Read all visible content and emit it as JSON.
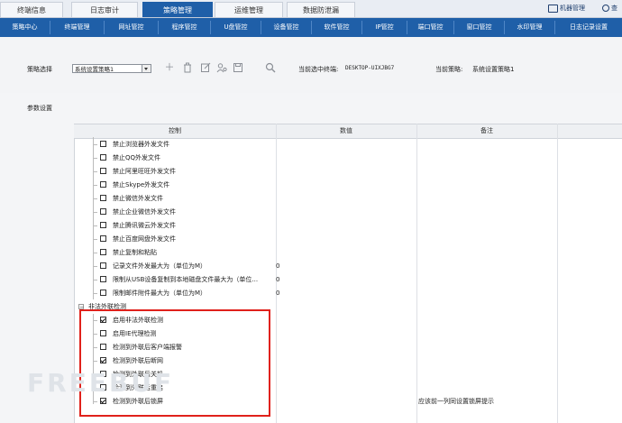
{
  "top_tabs": [
    {
      "label": "终端信息",
      "active": false
    },
    {
      "label": "日志审计",
      "active": false
    },
    {
      "label": "策略管理",
      "active": true
    },
    {
      "label": "运维管理",
      "active": false
    },
    {
      "label": "数据防泄漏",
      "active": false
    }
  ],
  "top_right": {
    "monitor_label": "机器管理",
    "search_label": "查"
  },
  "sub_tabs": [
    "策略中心",
    "终端管理",
    "网址管控",
    "程序管控",
    "U盘管控",
    "设备管控",
    "软件管控",
    "IP管控",
    "端口管控",
    "窗口管控",
    "水印管理",
    "日志记录设置"
  ],
  "policy_bar": {
    "select_label": "策略选择",
    "selected_policy": "系统设置策略1",
    "current_terminal_label": "当前选中终端:",
    "current_terminal": "DESKTOP-UIXJBG7",
    "current_policy_label": "当前策略:",
    "current_policy": "系统设置策略1"
  },
  "params": {
    "title": "参数设置",
    "columns": [
      "控制",
      "数值",
      "备注"
    ],
    "rows": [
      {
        "label": "禁止浏览器外发文件",
        "checked": false,
        "value": "",
        "note": ""
      },
      {
        "label": "禁止QQ外发文件",
        "checked": false,
        "value": "",
        "note": ""
      },
      {
        "label": "禁止阿里旺旺外发文件",
        "checked": false,
        "value": "",
        "note": ""
      },
      {
        "label": "禁止Skype外发文件",
        "checked": false,
        "value": "",
        "note": ""
      },
      {
        "label": "禁止微信外发文件",
        "checked": false,
        "value": "",
        "note": ""
      },
      {
        "label": "禁止企业微信外发文件",
        "checked": false,
        "value": "",
        "note": ""
      },
      {
        "label": "禁止腾讯微云外发文件",
        "checked": false,
        "value": "",
        "note": ""
      },
      {
        "label": "禁止百度网盘外发文件",
        "checked": false,
        "value": "",
        "note": ""
      },
      {
        "label": "禁止复制和粘贴",
        "checked": false,
        "value": "",
        "note": ""
      },
      {
        "label": "记录文件外发最大为（单位为M）",
        "checked": false,
        "value": "0",
        "note": ""
      },
      {
        "label": "限制从USB设备复制到本地磁盘文件最大为（单位...",
        "checked": false,
        "value": "0",
        "note": ""
      },
      {
        "label": "限制邮件附件最大为（单位为M）",
        "checked": false,
        "value": "0",
        "note": ""
      }
    ],
    "group_label": "非法外联检测",
    "group_rows": [
      {
        "label": "启用非法外联检测",
        "checked": true,
        "note": ""
      },
      {
        "label": "启用IE代理检测",
        "checked": false,
        "note": ""
      },
      {
        "label": "检测到外联后客户端报警",
        "checked": false,
        "note": ""
      },
      {
        "label": "检测到外联后断网",
        "checked": true,
        "note": ""
      },
      {
        "label": "检测到外联后关机",
        "checked": false,
        "note": ""
      },
      {
        "label": "检测到外联后重启",
        "checked": false,
        "note": ""
      },
      {
        "label": "检测到外联后锁屏",
        "checked": true,
        "note": "应该前一列同设置锁屏提示"
      }
    ]
  },
  "watermark": "FREEBUF",
  "colors": {
    "nav_blue": "#1f5fa8",
    "highlight_red": "#e0211b"
  }
}
